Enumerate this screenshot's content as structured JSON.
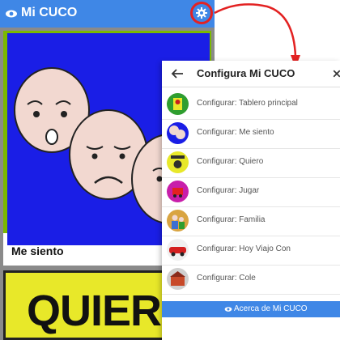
{
  "app": {
    "title": "Mi CUCO",
    "cards": [
      {
        "label": "Me siento"
      },
      {
        "label": "QUIERO"
      }
    ]
  },
  "dialog": {
    "title": "Configura Mi CUCO",
    "items": [
      {
        "label": "Configurar: Tablero principal",
        "icon": "tablero-icon",
        "color": "#2f9e2f"
      },
      {
        "label": "Configurar: Me siento",
        "icon": "me-siento-icon",
        "color": "#1a1ee6"
      },
      {
        "label": "Configurar: Quiero",
        "icon": "quiero-icon",
        "color": "#e8e829"
      },
      {
        "label": "Configurar: Jugar",
        "icon": "jugar-icon",
        "color": "#c81eaa"
      },
      {
        "label": "Configurar: Familia",
        "icon": "familia-icon",
        "color": "#d9a441"
      },
      {
        "label": "Configurar: Hoy Viajo Con",
        "icon": "viajo-icon",
        "color": "#d42020"
      },
      {
        "label": "Configurar: Cole",
        "icon": "cole-icon",
        "color": "#d0d0d0"
      }
    ],
    "about_label": "Acerca de Mi CUCO"
  },
  "colors": {
    "appbar": "#3f87e6",
    "highlight": "#e32222"
  }
}
